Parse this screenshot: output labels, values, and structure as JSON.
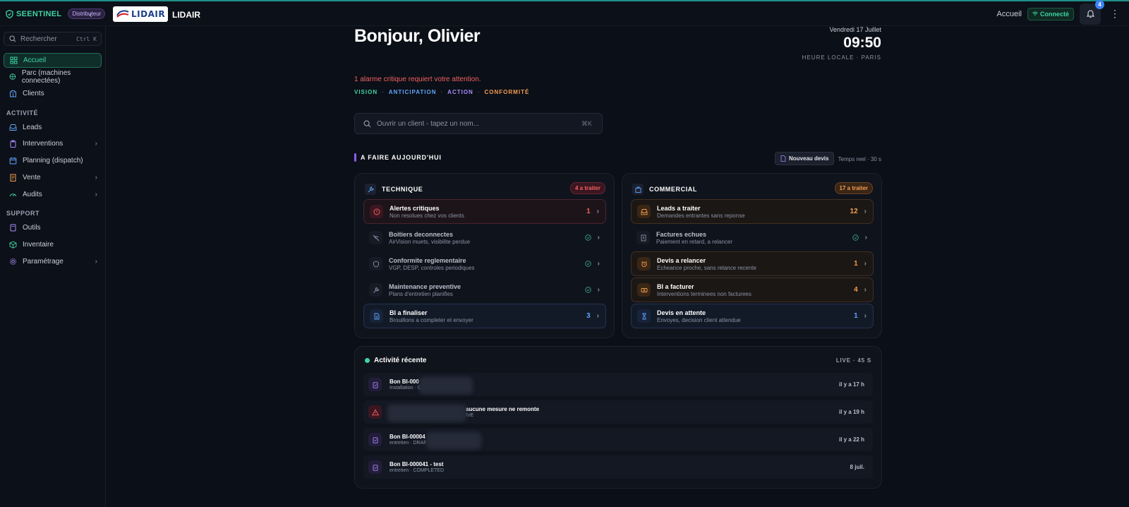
{
  "app": {
    "brand": "SEENTINEL",
    "role_badge": "Distributeur",
    "logo_text": "LIDAIR",
    "org_name": "LIDAIR"
  },
  "topbar": {
    "home_link": "Accueil",
    "status": "Connecté",
    "notification_count": "4"
  },
  "sidebar": {
    "search_placeholder": "Rechercher",
    "search_shortcut": "Ctrl K",
    "items_main": [
      {
        "label": "Accueil",
        "icon": "grid-icon",
        "active": true
      },
      {
        "label": "Parc (machines connectées)",
        "icon": "globe-icon"
      },
      {
        "label": "Clients",
        "icon": "building-icon"
      }
    ],
    "section_activity": "ACTIVITÉ",
    "items_activity": [
      {
        "label": "Leads",
        "icon": "inbox-icon"
      },
      {
        "label": "Interventions",
        "icon": "clipboard-icon",
        "chevron": true
      },
      {
        "label": "Planning (dispatch)",
        "icon": "calendar-icon"
      },
      {
        "label": "Vente",
        "icon": "receipt-icon",
        "chevron": true
      },
      {
        "label": "Audits",
        "icon": "gauge-icon",
        "chevron": true
      }
    ],
    "section_support": "SUPPORT",
    "items_support": [
      {
        "label": "Outils",
        "icon": "book-icon"
      },
      {
        "label": "Inventaire",
        "icon": "box-icon"
      },
      {
        "label": "Paramétrage",
        "icon": "gear-icon",
        "chevron": true
      }
    ]
  },
  "header": {
    "greeting": "Bonjour, Olivier",
    "date": "Vendredi 17 Juillet",
    "time": "09:50",
    "timezone": "HEURE LOCALE · PARIS",
    "alert": "1 alarme critique requiert votre attention.",
    "pillars": [
      {
        "label": "VISION",
        "color": "#3fd3a4"
      },
      {
        "label": "ANTICIPATION",
        "color": "#60a5fa"
      },
      {
        "label": "ACTION",
        "color": "#a78bfa"
      },
      {
        "label": "CONFORMITÉ",
        "color": "#f59e52"
      }
    ]
  },
  "client_search": {
    "placeholder": "Ouvrir un client - tapez un nom...",
    "shortcut": "⌘K"
  },
  "todo": {
    "title": "A FAIRE AUJOURD'HUI",
    "new_quote": "Nouveau devis",
    "realtime": "Temps reel · 30 s"
  },
  "technique": {
    "title": "TECHNIQUE",
    "badge": "4 a traiter",
    "rows": [
      {
        "title": "Alertes critiques",
        "sub": "Non resolues chez vos clients",
        "count": "1",
        "style": "red",
        "icon": "alert-circle-icon"
      },
      {
        "title": "Boitiers deconnectes",
        "sub": "AirVision muets, visibilite perdue",
        "count": "",
        "style": "none",
        "icon": "wifi-off-icon"
      },
      {
        "title": "Conformite reglementaire",
        "sub": "VGP, DESP, controles periodiques",
        "count": "",
        "style": "none",
        "icon": "shield-icon"
      },
      {
        "title": "Maintenance preventive",
        "sub": "Plans d'entretien planifies",
        "count": "",
        "style": "none",
        "icon": "wrench-icon"
      },
      {
        "title": "BI a finaliser",
        "sub": "Brouillons a completer et envoyer",
        "count": "3",
        "style": "blue",
        "icon": "file-icon"
      }
    ]
  },
  "commercial": {
    "title": "COMMERCIAL",
    "badge": "17 a traiter",
    "rows": [
      {
        "title": "Leads a traiter",
        "sub": "Demandes entrantes sans reponse",
        "count": "12",
        "style": "orange",
        "icon": "inbox-icon"
      },
      {
        "title": "Factures echues",
        "sub": "Paiement en retard, a relancer",
        "count": "",
        "style": "none",
        "icon": "invoice-icon"
      },
      {
        "title": "Devis a relancer",
        "sub": "Echeance proche, sans relance recente",
        "count": "1",
        "style": "orange",
        "icon": "alarm-icon"
      },
      {
        "title": "BI a facturer",
        "sub": "Interventions terminees non facturees",
        "count": "4",
        "style": "orange",
        "icon": "ticket-icon"
      },
      {
        "title": "Devis en attente",
        "sub": "Envoyes, decision client attendue",
        "count": "1",
        "style": "blue",
        "icon": "hourglass-icon"
      }
    ]
  },
  "activity": {
    "title": "Activité récente",
    "live": "LIVE · 45 S",
    "rows": [
      {
        "title": "Bon BI-000",
        "sub": "Installation · C",
        "time": "il y a 17 h",
        "icon": "clipboard-icon",
        "color": "#a78bfa"
      },
      {
        "title": "aucune mesure ne remonte",
        "sub": "IVE",
        "time": "il y a 19 h",
        "icon": "warning-icon",
        "color": "#f06161"
      },
      {
        "title": "Bon BI-00004",
        "sub": "entretien · DRAF",
        "time": "il y a 22 h",
        "icon": "clipboard-icon",
        "color": "#a78bfa"
      },
      {
        "title": "Bon BI-000041 - test",
        "sub": "entretien · COMPLETED",
        "time": "8 juil.",
        "icon": "clipboard-icon",
        "color": "#a78bfa"
      }
    ]
  },
  "colors": {
    "accent": "#3fd3a4",
    "critical": "#f06161",
    "warning": "#f59e52",
    "info": "#60a5fa",
    "purple": "#8b5cf6"
  }
}
